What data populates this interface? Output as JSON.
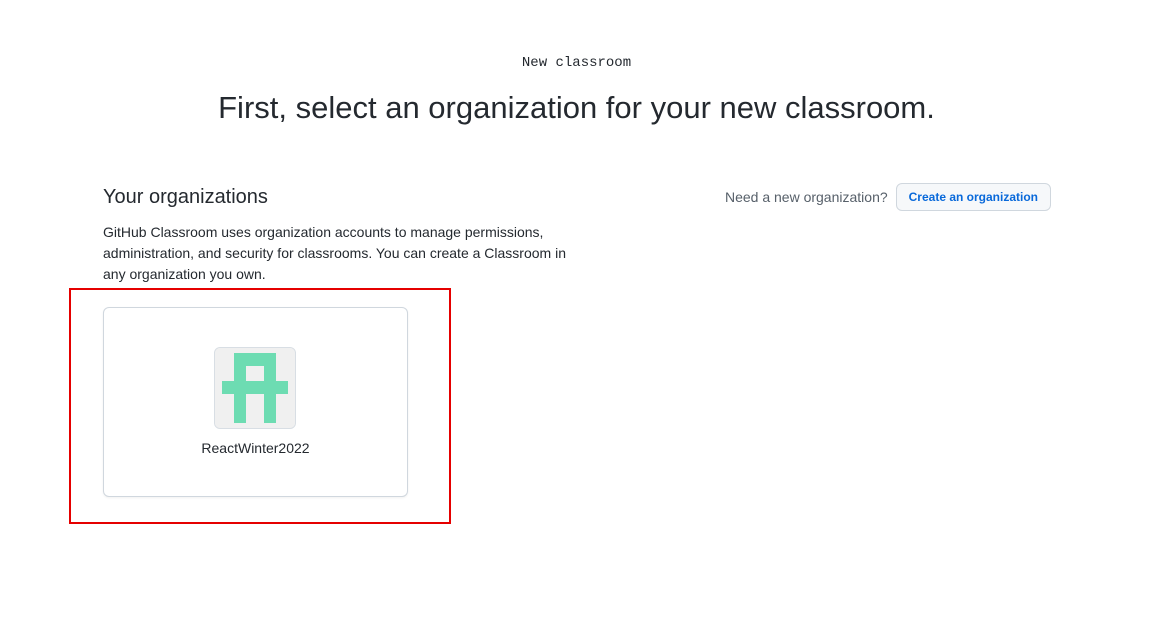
{
  "header": {
    "step_label": "New classroom",
    "title": "First, select an organization for your new classroom."
  },
  "organizations_section": {
    "title": "Your organizations",
    "description": "GitHub Classroom uses organization accounts to manage permissions, administration, and security for classrooms. You can create a Classroom in any organization you own.",
    "new_org_prompt": "Need a new organization?",
    "create_button_label": "Create an organization",
    "items": [
      {
        "name": "ReactWinter2022",
        "avatar_icon": "identicon",
        "avatar_color": "#6ddcb2"
      }
    ]
  },
  "colors": {
    "accent_link": "#0969da",
    "highlight": "#e50000",
    "text": "#24292f"
  }
}
